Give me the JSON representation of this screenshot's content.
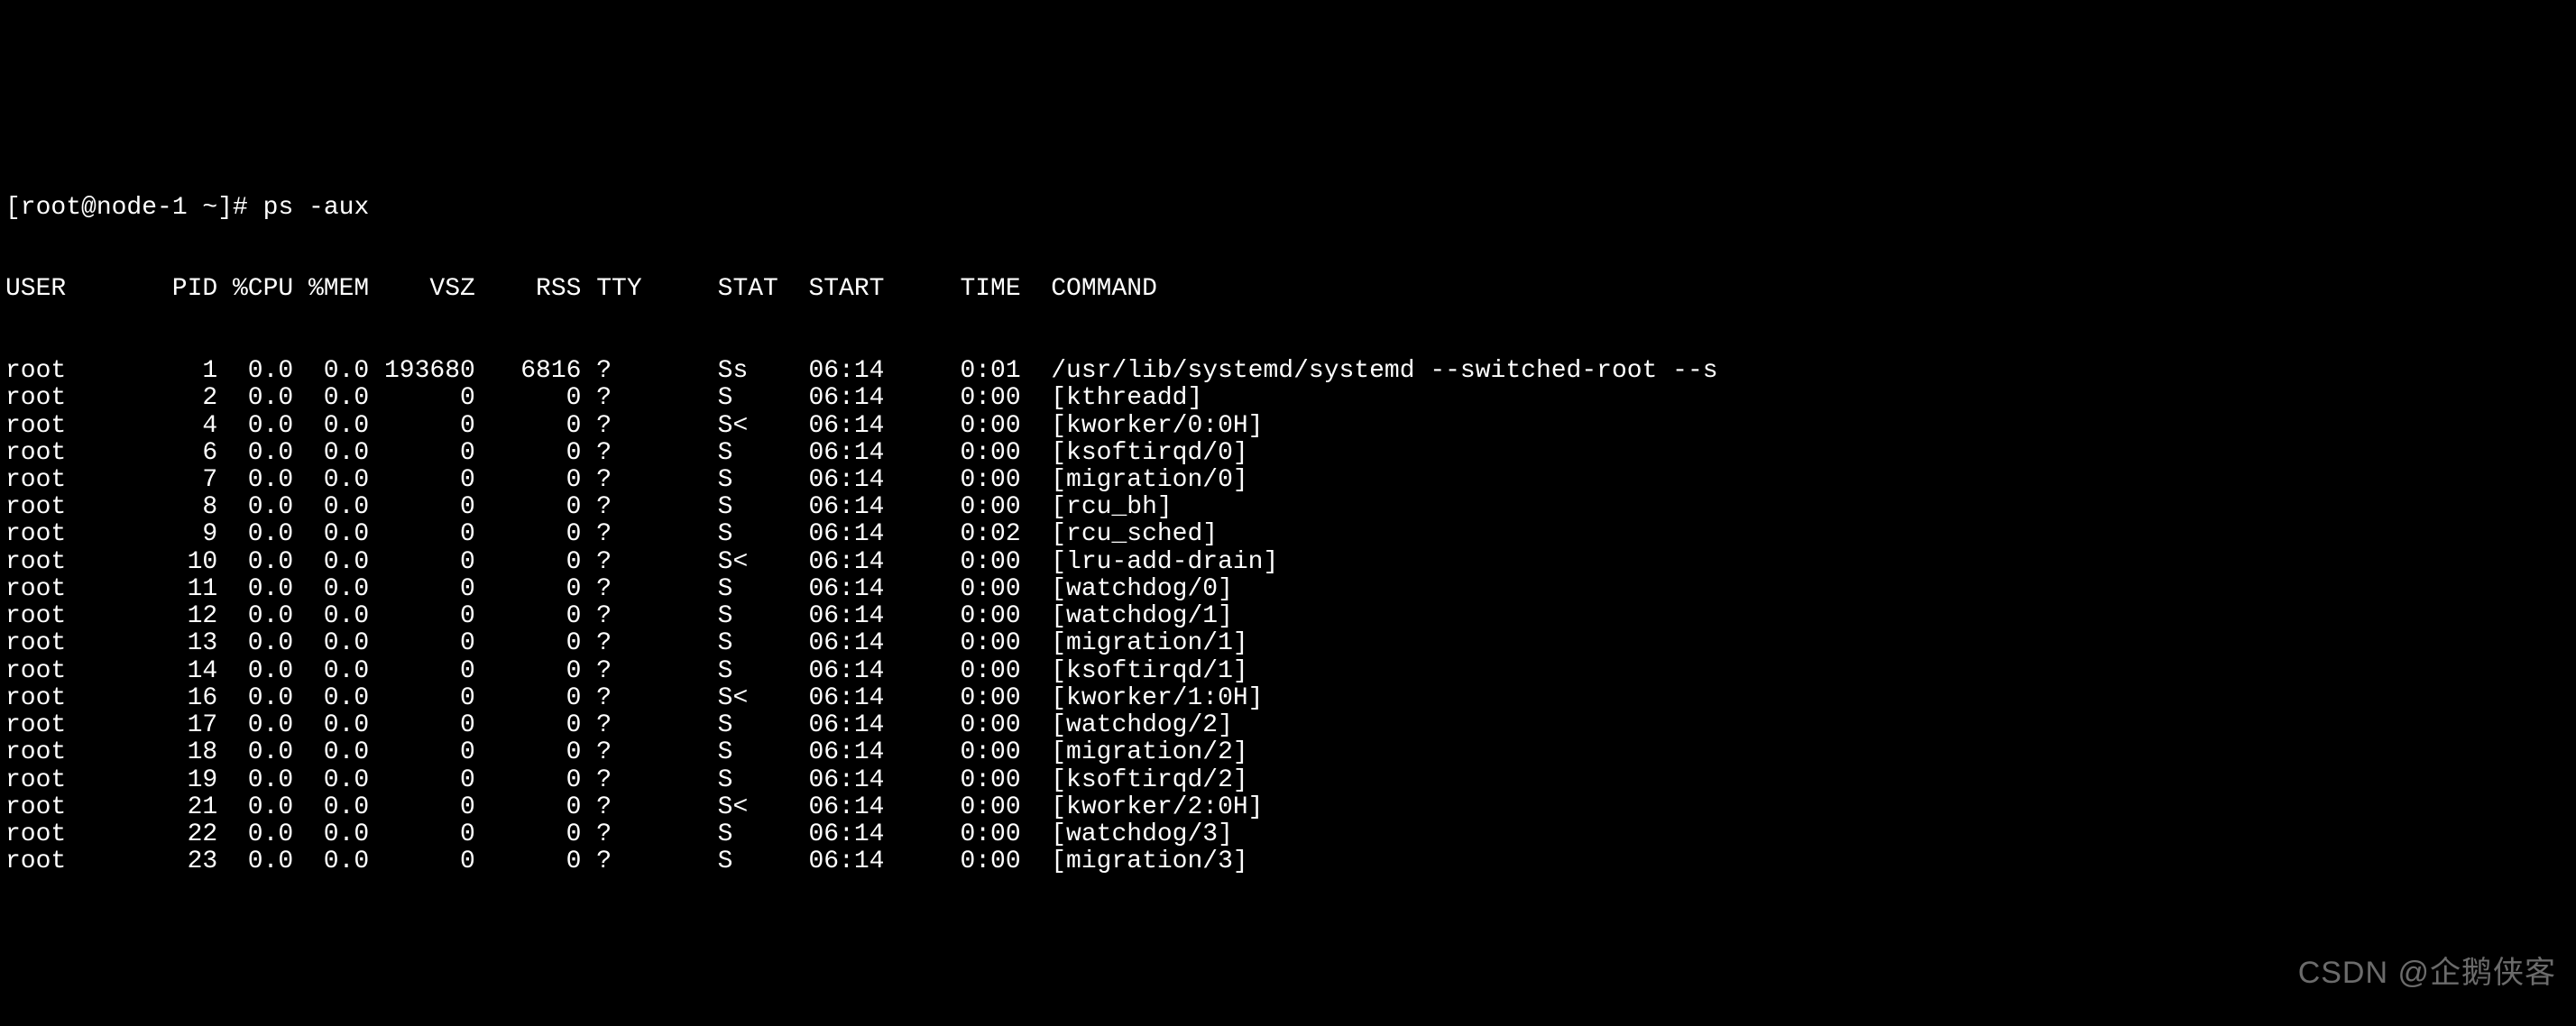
{
  "prompt": {
    "text": "[root@node-1 ~]# ps -aux"
  },
  "header": {
    "user": "USER",
    "pid": "PID",
    "cpu": "%CPU",
    "mem": "%MEM",
    "vsz": "VSZ",
    "rss": "RSS",
    "tty": "TTY",
    "stat": "STAT",
    "start": "START",
    "time": "TIME",
    "command": "COMMAND"
  },
  "rows": [
    {
      "user": "root",
      "pid": "1",
      "cpu": "0.0",
      "mem": "0.0",
      "vsz": "193680",
      "rss": "6816",
      "tty": "?",
      "stat": "Ss",
      "start": "06:14",
      "time": "0:01",
      "command": "/usr/lib/systemd/systemd --switched-root --s"
    },
    {
      "user": "root",
      "pid": "2",
      "cpu": "0.0",
      "mem": "0.0",
      "vsz": "0",
      "rss": "0",
      "tty": "?",
      "stat": "S",
      "start": "06:14",
      "time": "0:00",
      "command": "[kthreadd]"
    },
    {
      "user": "root",
      "pid": "4",
      "cpu": "0.0",
      "mem": "0.0",
      "vsz": "0",
      "rss": "0",
      "tty": "?",
      "stat": "S<",
      "start": "06:14",
      "time": "0:00",
      "command": "[kworker/0:0H]"
    },
    {
      "user": "root",
      "pid": "6",
      "cpu": "0.0",
      "mem": "0.0",
      "vsz": "0",
      "rss": "0",
      "tty": "?",
      "stat": "S",
      "start": "06:14",
      "time": "0:00",
      "command": "[ksoftirqd/0]"
    },
    {
      "user": "root",
      "pid": "7",
      "cpu": "0.0",
      "mem": "0.0",
      "vsz": "0",
      "rss": "0",
      "tty": "?",
      "stat": "S",
      "start": "06:14",
      "time": "0:00",
      "command": "[migration/0]"
    },
    {
      "user": "root",
      "pid": "8",
      "cpu": "0.0",
      "mem": "0.0",
      "vsz": "0",
      "rss": "0",
      "tty": "?",
      "stat": "S",
      "start": "06:14",
      "time": "0:00",
      "command": "[rcu_bh]"
    },
    {
      "user": "root",
      "pid": "9",
      "cpu": "0.0",
      "mem": "0.0",
      "vsz": "0",
      "rss": "0",
      "tty": "?",
      "stat": "S",
      "start": "06:14",
      "time": "0:02",
      "command": "[rcu_sched]"
    },
    {
      "user": "root",
      "pid": "10",
      "cpu": "0.0",
      "mem": "0.0",
      "vsz": "0",
      "rss": "0",
      "tty": "?",
      "stat": "S<",
      "start": "06:14",
      "time": "0:00",
      "command": "[lru-add-drain]"
    },
    {
      "user": "root",
      "pid": "11",
      "cpu": "0.0",
      "mem": "0.0",
      "vsz": "0",
      "rss": "0",
      "tty": "?",
      "stat": "S",
      "start": "06:14",
      "time": "0:00",
      "command": "[watchdog/0]"
    },
    {
      "user": "root",
      "pid": "12",
      "cpu": "0.0",
      "mem": "0.0",
      "vsz": "0",
      "rss": "0",
      "tty": "?",
      "stat": "S",
      "start": "06:14",
      "time": "0:00",
      "command": "[watchdog/1]"
    },
    {
      "user": "root",
      "pid": "13",
      "cpu": "0.0",
      "mem": "0.0",
      "vsz": "0",
      "rss": "0",
      "tty": "?",
      "stat": "S",
      "start": "06:14",
      "time": "0:00",
      "command": "[migration/1]"
    },
    {
      "user": "root",
      "pid": "14",
      "cpu": "0.0",
      "mem": "0.0",
      "vsz": "0",
      "rss": "0",
      "tty": "?",
      "stat": "S",
      "start": "06:14",
      "time": "0:00",
      "command": "[ksoftirqd/1]"
    },
    {
      "user": "root",
      "pid": "16",
      "cpu": "0.0",
      "mem": "0.0",
      "vsz": "0",
      "rss": "0",
      "tty": "?",
      "stat": "S<",
      "start": "06:14",
      "time": "0:00",
      "command": "[kworker/1:0H]"
    },
    {
      "user": "root",
      "pid": "17",
      "cpu": "0.0",
      "mem": "0.0",
      "vsz": "0",
      "rss": "0",
      "tty": "?",
      "stat": "S",
      "start": "06:14",
      "time": "0:00",
      "command": "[watchdog/2]"
    },
    {
      "user": "root",
      "pid": "18",
      "cpu": "0.0",
      "mem": "0.0",
      "vsz": "0",
      "rss": "0",
      "tty": "?",
      "stat": "S",
      "start": "06:14",
      "time": "0:00",
      "command": "[migration/2]"
    },
    {
      "user": "root",
      "pid": "19",
      "cpu": "0.0",
      "mem": "0.0",
      "vsz": "0",
      "rss": "0",
      "tty": "?",
      "stat": "S",
      "start": "06:14",
      "time": "0:00",
      "command": "[ksoftirqd/2]"
    },
    {
      "user": "root",
      "pid": "21",
      "cpu": "0.0",
      "mem": "0.0",
      "vsz": "0",
      "rss": "0",
      "tty": "?",
      "stat": "S<",
      "start": "06:14",
      "time": "0:00",
      "command": "[kworker/2:0H]"
    },
    {
      "user": "root",
      "pid": "22",
      "cpu": "0.0",
      "mem": "0.0",
      "vsz": "0",
      "rss": "0",
      "tty": "?",
      "stat": "S",
      "start": "06:14",
      "time": "0:00",
      "command": "[watchdog/3]"
    },
    {
      "user": "root",
      "pid": "23",
      "cpu": "0.0",
      "mem": "0.0",
      "vsz": "0",
      "rss": "0",
      "tty": "?",
      "stat": "S",
      "start": "06:14",
      "time": "0:00",
      "command": "[migration/3]"
    }
  ],
  "watermark": "CSDN @企鹅侠客"
}
